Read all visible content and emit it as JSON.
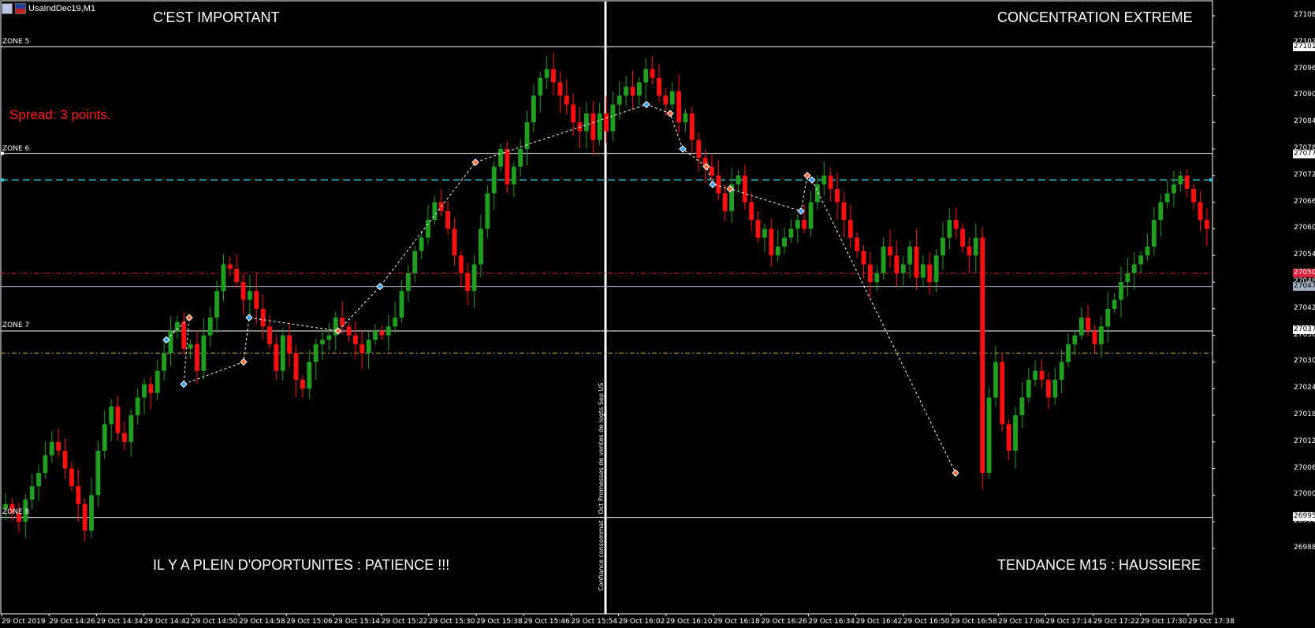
{
  "window": {
    "title": "UsaIndDec19,M1"
  },
  "texts": {
    "top_left": "C'EST IMPORTANT",
    "top_right": "CONCENTRATION EXTREME",
    "bottom_left": "IL Y A PLEIN D'OPORTUNITES : PATIENCE !!!",
    "bottom_right": "TENDANCE M15 : HAUSSIERE",
    "spread": "Spread: 3 points.",
    "vertical_event": "Confiance consommat - Oct  Promesses de ventes de logts Sep US"
  },
  "zones": [
    {
      "label": "ZONE 5",
      "price": 27101
    },
    {
      "label": "ZONE 6",
      "price": 27077
    },
    {
      "label": "ZONE 7",
      "price": 27037
    },
    {
      "label": "ZONE 8",
      "price": 26995
    }
  ],
  "levels": [
    {
      "price": 27071,
      "style": "dashed",
      "color": "#29c7d6"
    },
    {
      "price": 27050,
      "style": "dashdot",
      "color": "#e0203a",
      "tag": "27050"
    },
    {
      "price": 27047,
      "style": "solid",
      "color": "#9fb0c0",
      "tag": "27047"
    },
    {
      "price": 27032,
      "style": "dashdot",
      "color": "#c8a030"
    }
  ],
  "colors": {
    "bull": "#1f9e1f",
    "bear": "#ff1010",
    "doji": "#ffffff",
    "grid": "#ffffff",
    "background": "#000000"
  },
  "y_axis": {
    "labels": [
      "27108",
      "27102",
      "27096",
      "27090",
      "27084",
      "27078",
      "27072",
      "27066",
      "27060",
      "27054",
      "27048",
      "27042",
      "27036",
      "27030",
      "27024",
      "27018",
      "27012",
      "27006",
      "27000",
      "26994",
      "26988"
    ],
    "tag_zone5": "27101",
    "tag_zone6": "27077",
    "tag_zone7": "27037",
    "tag_zone8": "26995"
  },
  "x_axis": {
    "labels": [
      "29 Oct 2019",
      "29 Oct 14:26",
      "29 Oct 14:34",
      "29 Oct 14:42",
      "29 Oct 14:50",
      "29 Oct 14:58",
      "29 Oct 15:06",
      "29 Oct 15:14",
      "29 Oct 15:22",
      "29 Oct 15:30",
      "29 Oct 15:38",
      "29 Oct 15:46",
      "29 Oct 15:54",
      "29 Oct 16:02",
      "29 Oct 16:10",
      "29 Oct 16:18",
      "29 Oct 16:26",
      "29 Oct 16:34",
      "29 Oct 16:42",
      "29 Oct 16:50",
      "29 Oct 16:58",
      "29 Oct 17:06",
      "29 Oct 17:14",
      "29 Oct 17:22",
      "29 Oct 17:30",
      "29 Oct 17:38"
    ]
  },
  "chart_data": {
    "type": "candlestick",
    "symbol": "UsaIndDec19,M1",
    "price_range": [
      26985,
      27111
    ],
    "close_path": [
      26998,
      26996,
      26994,
      26999,
      27002,
      27005,
      27009,
      27012,
      27010,
      27006,
      27002,
      26998,
      26992,
      27000,
      27010,
      27016,
      27020,
      27014,
      27012,
      27018,
      27022,
      27025,
      27023,
      27028,
      27032,
      27037,
      27039,
      27033,
      27034,
      27028,
      27036,
      27040,
      27046,
      27052,
      27051,
      27048,
      27044,
      27046,
      27042,
      27038,
      27034,
      27028,
      27036,
      27032,
      27026,
      27024,
      27030,
      27034,
      27035,
      27036,
      27040,
      27038,
      27036,
      27034,
      27032,
      27035,
      27037,
      27036,
      27038,
      27040,
      27046,
      27050,
      27055,
      27058,
      27062,
      27066,
      27064,
      27060,
      27054,
      27050,
      27046,
      27052,
      27060,
      27068,
      27074,
      27078,
      27070,
      27074,
      27078,
      27084,
      27090,
      27094,
      27096,
      27093,
      27090,
      27088,
      27084,
      27082,
      27086,
      27080,
      27086,
      27082,
      27088,
      27090,
      27092,
      27090,
      27093,
      27096,
      27094,
      27090,
      27088,
      27091,
      27084,
      27086,
      27080,
      27076,
      27074,
      27072,
      27068,
      27064,
      27070,
      27072,
      27066,
      27062,
      27058,
      27060,
      27054,
      27056,
      27058,
      27060,
      27062,
      27060,
      27066,
      27070,
      27072,
      27069,
      27066,
      27062,
      27058,
      27055,
      27052,
      27048,
      27050,
      27056,
      27054,
      27050,
      27052,
      27056,
      27049,
      27052,
      27048,
      27054,
      27058,
      27062,
      27060,
      27056,
      27054,
      27058,
      27005,
      27022,
      27030,
      27016,
      27010,
      27018,
      27022,
      27026,
      27028,
      27026,
      27022,
      27026,
      27030,
      27034,
      27036,
      27040,
      27037,
      27034,
      27038,
      27042,
      27044,
      27048,
      27050,
      27052,
      27054,
      27056,
      27062,
      27066,
      27068,
      27070,
      27072,
      27069,
      27066,
      27062,
      27060
    ],
    "swing_points": [
      [
        211,
        27035
      ],
      [
        240,
        27040
      ],
      [
        233,
        27025
      ],
      [
        309,
        27030
      ],
      [
        316,
        27040
      ],
      [
        429,
        27037
      ],
      [
        482,
        27047
      ],
      [
        603,
        27075
      ],
      [
        820,
        27088
      ],
      [
        850,
        27086
      ],
      [
        866,
        27078
      ],
      [
        896,
        27074
      ],
      [
        904,
        27070
      ],
      [
        926,
        27069
      ],
      [
        1016,
        27064
      ],
      [
        1024,
        27072
      ],
      [
        1030,
        27071
      ],
      [
        1212,
        27005
      ]
    ]
  }
}
